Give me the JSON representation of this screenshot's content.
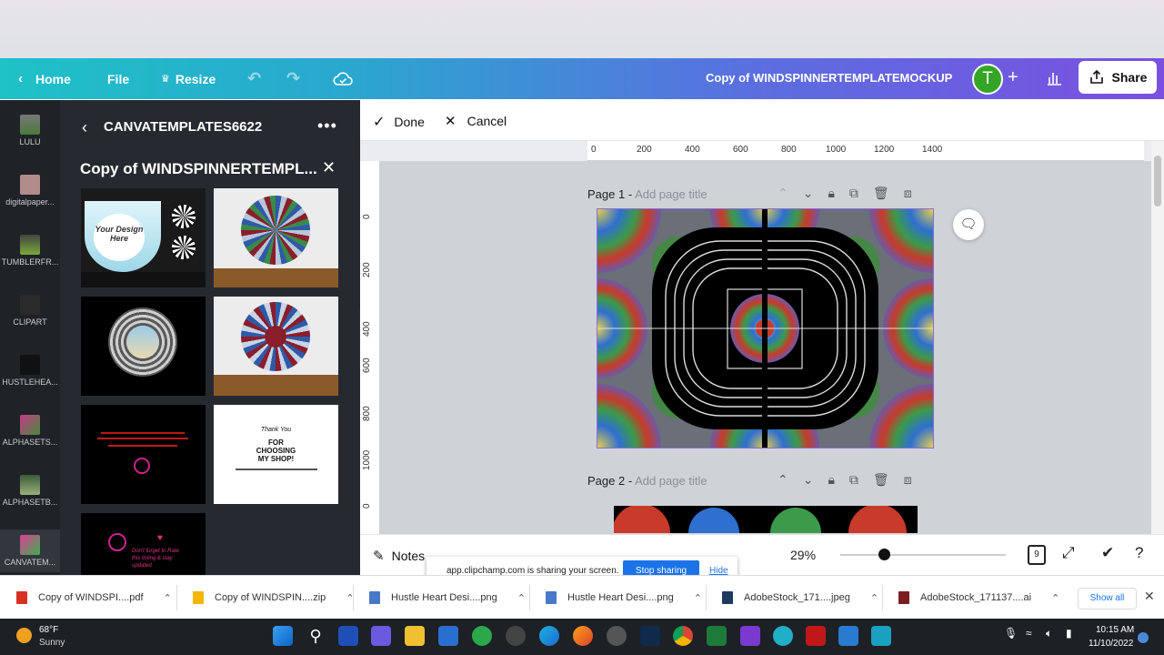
{
  "header": {
    "home": "Home",
    "file": "File",
    "resize": "Resize",
    "doc_title": "Copy of WINDSPINNERTEMPLATEMOCKUP",
    "avatar_initial": "T",
    "share": "Share"
  },
  "rail": {
    "items": [
      "LULU",
      "digitalpaper...",
      "TUMBLERFR...",
      "CLIPART",
      "HUSTLEHEA...",
      "ALPHASETS...",
      "ALPHASETB...",
      "CANVATEM..."
    ]
  },
  "panel": {
    "folder": "CANVATEMPLATES6622",
    "title": "Copy of WINDSPINNERTEMPL...",
    "thumb1_text": "Your Design Here",
    "thumb6_lines": [
      "Thank You",
      "FOR",
      "CHOOSING",
      "MY SHOP!"
    ],
    "thumb7_text": "Don't forget to Rate this listing & stay updated"
  },
  "toolbar": {
    "done": "Done",
    "cancel": "Cancel"
  },
  "ruler": {
    "h_ticks": [
      "0",
      "200",
      "400",
      "600",
      "800",
      "1000",
      "1200",
      "1400"
    ],
    "v_ticks": [
      "0",
      "200",
      "400",
      "600",
      "800",
      "1000",
      "0"
    ]
  },
  "pages": [
    {
      "label": "Page 1 -",
      "title_placeholder": "Add page title"
    },
    {
      "label": "Page 2 -",
      "title_placeholder": "Add page title"
    }
  ],
  "bottom": {
    "notes": "Notes",
    "zoom": "29%",
    "zoom_level": 0.29,
    "page_count": "9"
  },
  "share_toast": {
    "message": "app.clipchamp.com is sharing your screen.",
    "stop": "Stop sharing",
    "hide": "Hide"
  },
  "downloads": {
    "items": [
      {
        "name": "Copy of WINDSPI....pdf",
        "color": "#d93025"
      },
      {
        "name": "Copy of WINDSPIN....zip",
        "color": "#f2b705"
      },
      {
        "name": "Hustle Heart Desi....png",
        "color": "#4a78c9"
      },
      {
        "name": "Hustle Heart Desi....png",
        "color": "#4a78c9"
      },
      {
        "name": "AdobeStock_171....jpeg",
        "color": "#1e3a5f"
      },
      {
        "name": "AdobeStock_171137....ai",
        "color": "#7a1f1f"
      }
    ],
    "show_all": "Show all"
  },
  "taskbar": {
    "temp": "68°F",
    "condition": "Sunny",
    "time": "10:15 AM",
    "date": "11/10/2022"
  },
  "colors": {
    "header_start": "#1ec2c7",
    "header_end": "#7b4fe0",
    "accent_blue": "#1a73e8",
    "avatar_green": "#35a526"
  }
}
